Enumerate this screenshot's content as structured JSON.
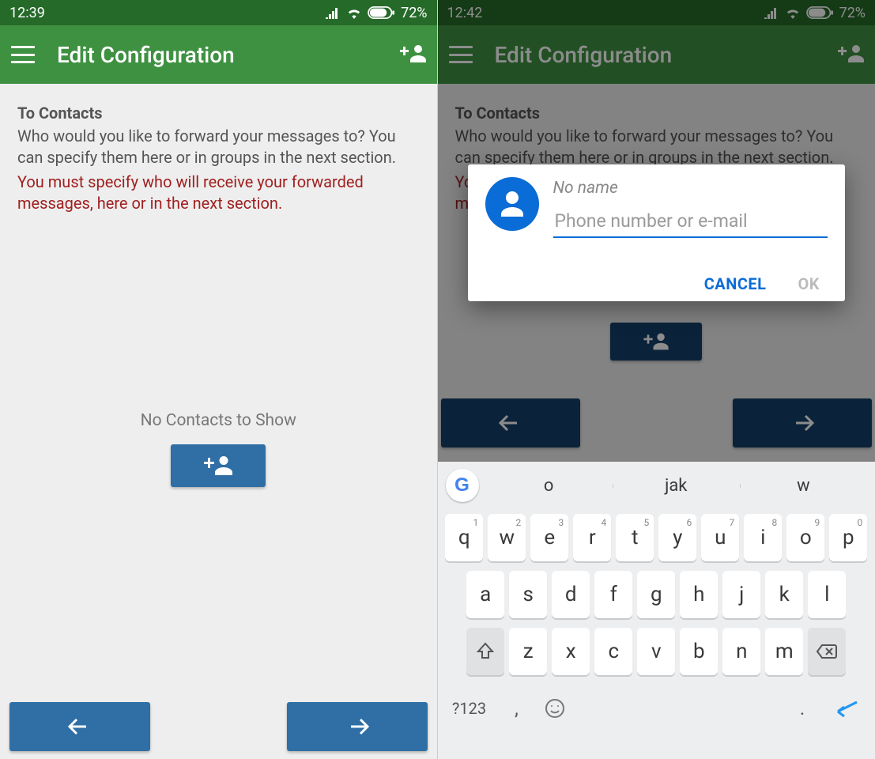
{
  "left": {
    "statusbar": {
      "time": "12:39",
      "battery": "72%"
    },
    "appbar": {
      "title": "Edit Configuration"
    },
    "content": {
      "heading": "To Contacts",
      "body": "Who would you like to forward your messages to? You can specify them here or in groups in the next section.",
      "warning": "You must specify who will receive your forwarded messages, here or in the next section."
    },
    "empty": {
      "message": "No Contacts to Show"
    }
  },
  "right": {
    "statusbar": {
      "time": "12:42",
      "battery": "72%"
    },
    "appbar": {
      "title": "Edit Configuration"
    },
    "content": {
      "heading": "To Contacts",
      "body": "Who would you like to forward your messages to? You can specify them here or in groups in the next section.",
      "warning_partial": "You must specify who will receive your forwarded messages, here or in the next section."
    },
    "dialog": {
      "noname": "No name",
      "placeholder": "Phone number or e-mail",
      "cancel": "CANCEL",
      "ok": "OK"
    },
    "keyboard": {
      "suggestions": [
        "o",
        "jak",
        "w"
      ],
      "row1": [
        {
          "k": "q",
          "s": "1"
        },
        {
          "k": "w",
          "s": "2"
        },
        {
          "k": "e",
          "s": "3"
        },
        {
          "k": "r",
          "s": "4"
        },
        {
          "k": "t",
          "s": "5"
        },
        {
          "k": "y",
          "s": "6"
        },
        {
          "k": "u",
          "s": "7"
        },
        {
          "k": "i",
          "s": "8"
        },
        {
          "k": "o",
          "s": "9"
        },
        {
          "k": "p",
          "s": "0"
        }
      ],
      "row2": [
        "a",
        "s",
        "d",
        "f",
        "g",
        "h",
        "j",
        "k",
        "l"
      ],
      "row3": [
        "z",
        "x",
        "c",
        "v",
        "b",
        "n",
        "m"
      ],
      "sym": "?123",
      "comma": ",",
      "dot": "."
    }
  }
}
